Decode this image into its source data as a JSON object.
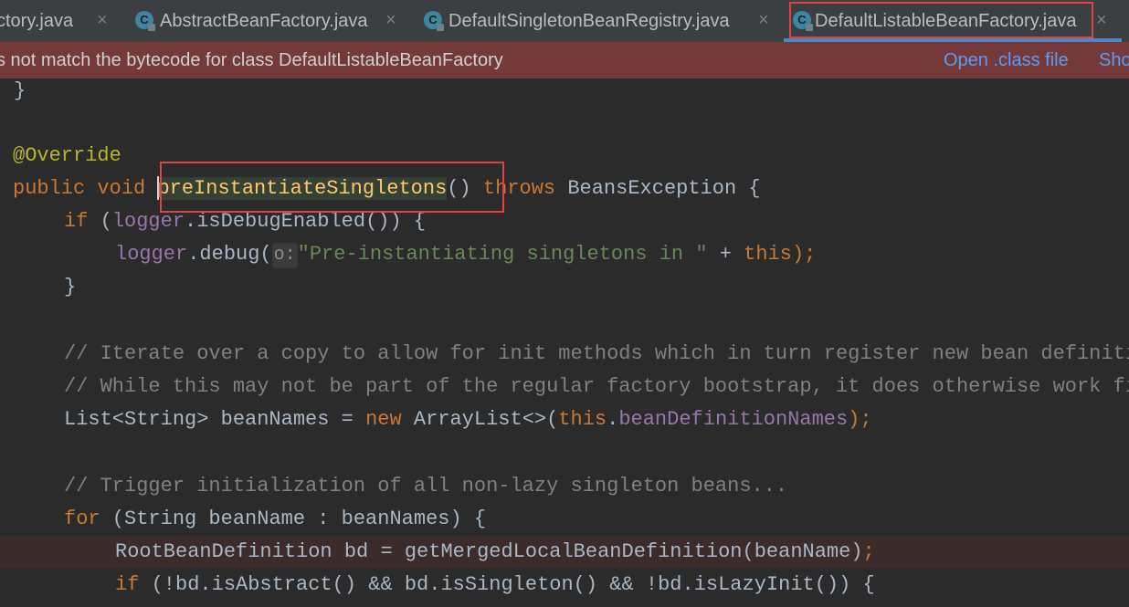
{
  "tabs": [
    {
      "label": "ctory.java",
      "close": "×"
    },
    {
      "label": "AbstractBeanFactory.java",
      "close": "×",
      "icon": "java-class-icon"
    },
    {
      "label": "DefaultSingletonBeanRegistry.java",
      "close": "×",
      "icon": "java-class-icon"
    },
    {
      "label": "DefaultListableBeanFactory.java",
      "close": "×",
      "icon": "java-class-icon",
      "active": true
    }
  ],
  "banner": {
    "message": "s not match the bytecode for class DefaultListableBeanFactory",
    "open_class": "Open .class file",
    "show": "Sho"
  },
  "code": {
    "l1_brace": "}",
    "l3_annotation": "@Override",
    "l4_public": "public",
    "l4_void": "void",
    "l4_method": "preInstantiateSingletons",
    "l4_parens": "()",
    "l4_throws": "throws",
    "l4_exception": "BeansException {",
    "l5_if": "if",
    "l5_open": " (",
    "l5_logger": "logger",
    "l5_rest": ".isDebugEnabled()) {",
    "l6_logger": "logger",
    "l6_debug": ".debug(",
    "l6_hint": "o:",
    "l6_string": "\"Pre-instantiating singletons in \"",
    "l6_plus": " + ",
    "l6_this": "this",
    "l6_end": ");",
    "l7_brace": "}",
    "l9_comment": "// Iterate over a copy to allow for init methods which in turn register new bean definitions.",
    "l10_comment": "// While this may not be part of the regular factory bootstrap, it does otherwise work fine.",
    "l11_start": "List<String> beanNames = ",
    "l11_new": "new",
    "l11_mid": " ArrayList<>(",
    "l11_this": "this",
    "l11_dot": ".",
    "l11_field": "beanDefinitionNames",
    "l11_end": ");",
    "l13_comment": "// Trigger initialization of all non-lazy singleton beans...",
    "l14_for": "for",
    "l14_rest": " (String beanName : beanNames) {",
    "l15_code": "RootBeanDefinition bd = getMergedLocalBeanDefinition(beanName)",
    "l15_semi": ";",
    "l16_if": "if",
    "l16_rest": " (!bd.isAbstract() && bd.isSingleton() && !bd.isLazyInit()) {"
  },
  "colors": {
    "editor_bg": "#2b2b2b",
    "banner_bg": "#743a3a",
    "keyword": "#cc7832",
    "method": "#ffc66d",
    "string": "#6a8759",
    "comment": "#808080",
    "field": "#9876aa",
    "annotation": "#bbb529",
    "highlight_box": "#e04343"
  }
}
